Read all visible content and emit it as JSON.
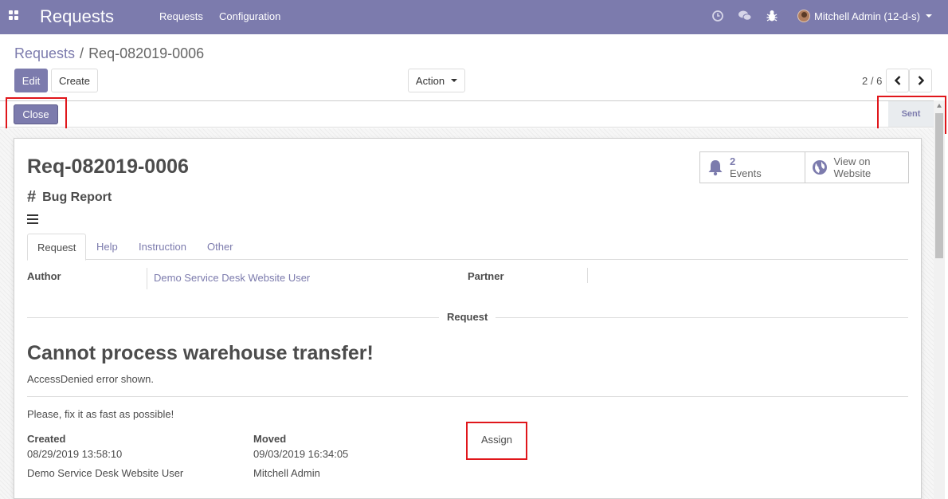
{
  "navbar": {
    "app_title": "Requests",
    "menu": [
      "Requests",
      "Configuration"
    ],
    "user": "Mitchell Admin (12-d-s)"
  },
  "breadcrumb": {
    "parent": "Requests",
    "current": "Req-082019-0006"
  },
  "buttons": {
    "edit": "Edit",
    "create": "Create",
    "action": "Action"
  },
  "pager": {
    "value": "2 / 6"
  },
  "statusbar": {
    "close": "Close",
    "stage": "Sent"
  },
  "record": {
    "title": "Req-082019-0006",
    "category": "Bug Report",
    "smart_buttons": {
      "events_count": "2",
      "events_label": "Events",
      "website_line1": "View on",
      "website_line2": "Website"
    },
    "tabs": [
      "Request",
      "Help",
      "Instruction",
      "Other"
    ],
    "author_label": "Author",
    "author_value": "Demo Service Desk Website User",
    "partner_label": "Partner",
    "partner_value": "",
    "section_label": "Request",
    "subject": "Cannot process warehouse transfer!",
    "description": "AccessDenied error shown.",
    "note": "Please, fix it as fast as possible!",
    "created_label": "Created",
    "created_date": "08/29/2019 13:58:10",
    "created_by": "Demo Service Desk Website User",
    "moved_label": "Moved",
    "moved_date": "09/03/2019 16:34:05",
    "moved_by": "Mitchell Admin",
    "assign": "Assign"
  },
  "colors": {
    "brand": "#7c7bad",
    "highlight": "#e0161b",
    "text": "#4c4c4c"
  },
  "icons": [
    "apps-icon",
    "clock-icon",
    "chat-icon",
    "bug-icon",
    "caret-down-icon",
    "chevron-left-icon",
    "chevron-right-icon",
    "bell-icon",
    "globe-icon",
    "hash-icon",
    "menu-icon"
  ]
}
